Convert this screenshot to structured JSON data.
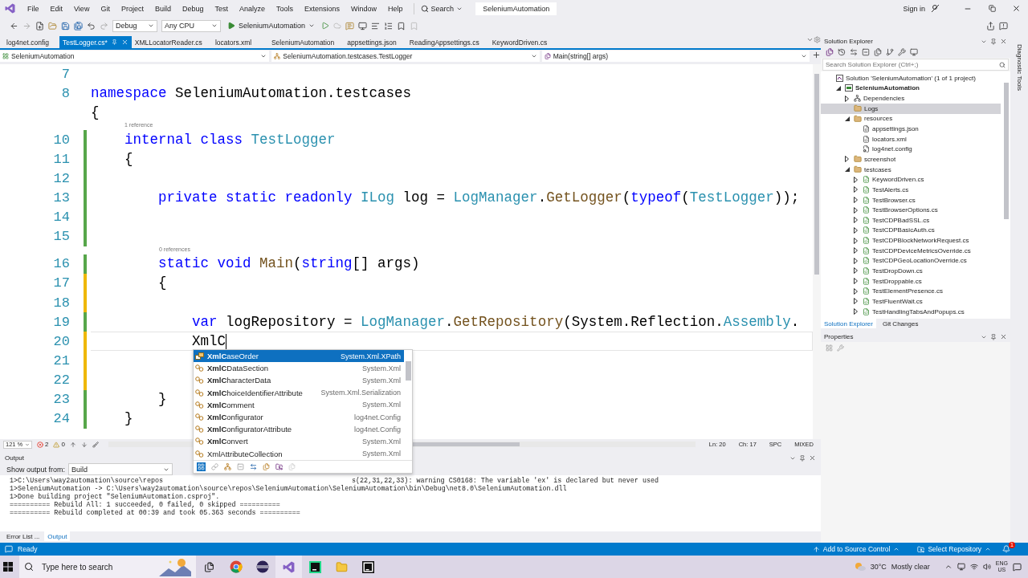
{
  "menu_bar": {
    "items": [
      "File",
      "Edit",
      "View",
      "Git",
      "Project",
      "Build",
      "Debug",
      "Test",
      "Analyze",
      "Tools",
      "Extensions",
      "Window",
      "Help"
    ],
    "search": "Search",
    "project": "SeleniumAutomation",
    "sign_in": "Sign in"
  },
  "toolbar": {
    "configuration": "Debug",
    "platform": "Any CPU",
    "run_target": "SeleniumAutomation"
  },
  "doc_tabs": [
    {
      "label": "log4net.config",
      "selected": false
    },
    {
      "label": "TestLogger.cs*",
      "selected": true
    },
    {
      "label": "XMLLocatorReader.cs",
      "selected": false
    },
    {
      "label": "locators.xml",
      "selected": false
    },
    {
      "label": "SeleniumAutomation",
      "selected": false
    },
    {
      "label": "appsettings.json",
      "selected": false
    },
    {
      "label": "ReadingAppsettings.cs",
      "selected": false
    },
    {
      "label": "KeywordDriven.cs",
      "selected": false
    }
  ],
  "nav_bar": {
    "project": "SeleniumAutomation",
    "type": "SeleniumAutomation.testcases.TestLogger",
    "member": "Main(string[] args)"
  },
  "editor": {
    "lines": [
      {
        "number": "7",
        "current": false
      },
      {
        "number": "8",
        "current": false,
        "tokens": [
          {
            "kind": "keyword",
            "text": "namespace"
          },
          {
            "kind": "plain",
            "text": " SeleniumAutomation.testcases"
          }
        ]
      },
      {
        "current": false,
        "tokens": [
          {
            "kind": "plain",
            "text": "{"
          }
        ]
      },
      {
        "number": "10",
        "codelens": "1 reference",
        "current": false,
        "color": "#57a64a",
        "tokens": [
          {
            "kind": "keyword",
            "text": "    internal class "
          },
          {
            "kind": "type",
            "text": "TestLogger"
          }
        ]
      },
      {
        "number": "11",
        "current": false,
        "color": "#57a64a",
        "tokens": [
          {
            "kind": "plain",
            "text": "    {"
          }
        ]
      },
      {
        "number": "12",
        "current": false,
        "color": "#57a64a"
      },
      {
        "number": "13",
        "current": false,
        "color": "#57a64a",
        "tokens": [
          {
            "kind": "keyword",
            "text": "        private static readonly "
          },
          {
            "kind": "type",
            "text": "ILog"
          },
          {
            "kind": "plain",
            "text": " log = "
          },
          {
            "kind": "type",
            "text": "LogManager"
          },
          {
            "kind": "plain",
            "text": "."
          },
          {
            "kind": "method",
            "text": "GetLogger"
          },
          {
            "kind": "plain",
            "text": "("
          },
          {
            "kind": "keyword",
            "text": "typeof"
          },
          {
            "kind": "plain",
            "text": "("
          },
          {
            "kind": "type",
            "text": "TestLogger"
          },
          {
            "kind": "plain",
            "text": "));"
          }
        ]
      },
      {
        "number": "14",
        "current": false,
        "color": "#57a64a"
      },
      {
        "number": "15",
        "current": false,
        "color": "#57a64a"
      },
      {
        "number": "16",
        "codelens": "0 references",
        "current": false,
        "color": "#57a64a",
        "tokens": [
          {
            "kind": "keyword",
            "text": "        static void "
          },
          {
            "kind": "method",
            "text": "Main"
          },
          {
            "kind": "plain",
            "text": "("
          },
          {
            "kind": "keyword",
            "text": "string"
          },
          {
            "kind": "plain",
            "text": "[] args)"
          }
        ]
      },
      {
        "number": "17",
        "current": false,
        "color": "#efb700",
        "tokens": [
          {
            "kind": "plain",
            "text": "        {"
          }
        ]
      },
      {
        "number": "18",
        "current": false,
        "color": "#efb700"
      },
      {
        "number": "19",
        "current": false,
        "color": "#57a64a",
        "tokens": [
          {
            "kind": "keyword",
            "text": "            var"
          },
          {
            "kind": "plain",
            "text": " logRepository = "
          },
          {
            "kind": "type",
            "text": "LogManager"
          },
          {
            "kind": "plain",
            "text": "."
          },
          {
            "kind": "method",
            "text": "GetRepository"
          },
          {
            "kind": "plain",
            "text": "(System.Reflection."
          },
          {
            "kind": "type",
            "text": "Assembly"
          },
          {
            "kind": "plain",
            "text": "."
          }
        ]
      },
      {
        "number": "20",
        "current": true,
        "color": "#efb700",
        "tokens": [
          {
            "kind": "plain",
            "text": "            XmlC"
          }
        ]
      },
      {
        "number": "21",
        "current": false,
        "color": "#efb700"
      },
      {
        "number": "22",
        "current": false,
        "color": "#efb700"
      },
      {
        "number": "23",
        "current": false,
        "color": "#57a64a",
        "tokens": [
          {
            "kind": "plain",
            "text": "        }"
          }
        ]
      },
      {
        "number": "24",
        "current": false,
        "color": "#57a64a",
        "tokens": [
          {
            "kind": "plain",
            "text": "    }"
          }
        ]
      }
    ]
  },
  "completion": {
    "items": [
      {
        "kind": "enum",
        "name": "**XmlC**aseOrder",
        "namespace": "System.Xml.XPath",
        "selected": true
      },
      {
        "kind": "class",
        "name": "**XmlC**DataSection",
        "namespace": "System.Xml",
        "selected": false
      },
      {
        "kind": "class",
        "name": "**XmlC**haracterData",
        "namespace": "System.Xml",
        "selected": false
      },
      {
        "kind": "class",
        "name": "**XmlC**hoiceIdentifierAttribute",
        "namespace": "System.Xml.Serialization",
        "selected": false
      },
      {
        "kind": "class",
        "name": "**XmlC**omment",
        "namespace": "System.Xml",
        "selected": false
      },
      {
        "kind": "class",
        "name": "**XmlC**onfigurator",
        "namespace": "log4net.Config",
        "selected": false
      },
      {
        "kind": "class",
        "name": "**XmlC**onfiguratorAttribute",
        "namespace": "log4net.Config",
        "selected": false
      },
      {
        "kind": "class",
        "name": "**XmlC**onvert",
        "namespace": "System.Xml",
        "selected": false
      },
      {
        "kind": "class",
        "name": "XmlAttributeCollection",
        "namespace": "System.Xml",
        "selected": false
      }
    ]
  },
  "editor_status": {
    "zoom": "121 %",
    "errors": "2",
    "warnings": "0",
    "line": "Ln: 20",
    "column": "Ch: 17",
    "whitespace": "SPC",
    "line_endings": "MIXED"
  },
  "output": {
    "title": "Output",
    "show_from_label": "Show output from:",
    "source": "Build",
    "partial_line": {
      "start": "1>C:\\Users\\way2automation\\source\\repos",
      "end": "s(22,31,22,33): warning CS0168: The variable 'ex' is declared but never used"
    },
    "lines": [
      "1>SeleniumAutomation -> C:\\Users\\way2automation\\source\\repos\\SeleniumAutomation\\SeleniumAutomation\\bin\\Debug\\net8.0\\SeleniumAutomation.dll",
      "1>Done building project \"SeleniumAutomation.csproj\".",
      "========== Rebuild All: 1 succeeded, 0 failed, 0 skipped ==========",
      "========== Rebuild completed at 00:39 and took 05.363 seconds =========="
    ]
  },
  "bottom_tabs": [
    {
      "label": "Error List ...",
      "selected": false
    },
    {
      "label": "Output",
      "selected": true
    }
  ],
  "solution_explorer": {
    "title": "Solution Explorer",
    "search_placeholder": "Search Solution Explorer (Ctrl+;)",
    "tree": [
      {
        "label": "Solution 'SeleniumAutomation' (1 of 1 project)",
        "kind": "solution",
        "selected": false,
        "children": [
          {
            "label": "SeleniumAutomation",
            "kind": "project",
            "expanded": true,
            "selected": false,
            "children": [
              {
                "label": "Dependencies",
                "kind": "deps",
                "expanded": false,
                "selected": false
              },
              {
                "label": "Logs",
                "kind": "folder",
                "selected": true
              },
              {
                "label": "resources",
                "kind": "folder",
                "expanded": true,
                "selected": false,
                "children": [
                  {
                    "label": "appsettings.json",
                    "kind": "json",
                    "selected": false
                  },
                  {
                    "label": "locators.xml",
                    "kind": "xml",
                    "selected": false
                  },
                  {
                    "label": "log4net.config",
                    "kind": "config",
                    "selected": false
                  }
                ]
              },
              {
                "label": "screenshot",
                "kind": "folder",
                "expanded": false,
                "selected": false
              },
              {
                "label": "testcases",
                "kind": "folder",
                "expanded": true,
                "selected": false,
                "children": [
                  {
                    "label": "KeywordDriven.cs",
                    "kind": "cs",
                    "expanded": false,
                    "selected": false
                  },
                  {
                    "label": "TestAlerts.cs",
                    "kind": "cs",
                    "expanded": false,
                    "selected": false
                  },
                  {
                    "label": "TestBrowser.cs",
                    "kind": "cs",
                    "expanded": false,
                    "selected": false
                  },
                  {
                    "label": "TestBrowserOptions.cs",
                    "kind": "cs",
                    "expanded": false,
                    "selected": false
                  },
                  {
                    "label": "TestCDPBadSSL.cs",
                    "kind": "cs",
                    "expanded": false,
                    "selected": false
                  },
                  {
                    "label": "TestCDPBasicAuth.cs",
                    "kind": "cs",
                    "expanded": false,
                    "selected": false
                  },
                  {
                    "label": "TestCDPBlockNetworkRequest.cs",
                    "kind": "cs",
                    "expanded": false,
                    "selected": false
                  },
                  {
                    "label": "TestCDPDeviceMetricsOverride.cs",
                    "kind": "cs",
                    "expanded": false,
                    "selected": false
                  },
                  {
                    "label": "TestCDPGeoLocationOverride.cs",
                    "kind": "cs",
                    "expanded": false,
                    "selected": false
                  },
                  {
                    "label": "TestDropDown.cs",
                    "kind": "cs",
                    "expanded": false,
                    "selected": false
                  },
                  {
                    "label": "TestDroppable.cs",
                    "kind": "cs",
                    "expanded": false,
                    "selected": false
                  },
                  {
                    "label": "TestElementPresence.cs",
                    "kind": "cs",
                    "expanded": false,
                    "selected": false
                  },
                  {
                    "label": "TestFluentWait.cs",
                    "kind": "cs",
                    "expanded": false,
                    "selected": false
                  },
                  {
                    "label": "TestHandlingTabsAndPopups.cs",
                    "kind": "cs",
                    "expanded": false,
                    "selected": false
                  }
                ]
              }
            ]
          }
        ]
      }
    ],
    "tabs": [
      {
        "label": "Solution Explorer",
        "selected": true
      },
      {
        "label": "Git Changes",
        "selected": false
      }
    ]
  },
  "properties": {
    "title": "Properties"
  },
  "side_tab": "Diagnostic Tools",
  "status_bar": {
    "status": "Ready",
    "source_control": "Add to Source Control",
    "repository": "Select Repository",
    "notifications": "1"
  },
  "taskbar": {
    "search_placeholder": "Type here to search",
    "temperature": "30°C",
    "weather": "Mostly clear",
    "language": "ENG",
    "region": "US"
  }
}
